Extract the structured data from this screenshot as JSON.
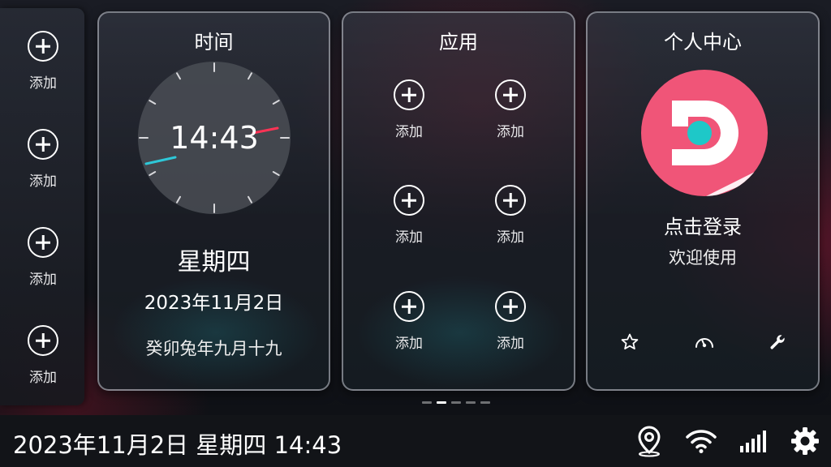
{
  "dock": {
    "slots": [
      {
        "label": "添加"
      },
      {
        "label": "添加"
      },
      {
        "label": "添加"
      },
      {
        "label": "添加"
      }
    ]
  },
  "time_card": {
    "title": "时间",
    "clock_time": "14:43",
    "weekday": "星期四",
    "date": "2023年11月2日",
    "lunar_date": "癸卯兔年九月十九"
  },
  "apps_card": {
    "title": "应用",
    "slots": [
      {
        "label": "添加"
      },
      {
        "label": "添加"
      },
      {
        "label": "添加"
      },
      {
        "label": "添加"
      },
      {
        "label": "添加"
      },
      {
        "label": "添加"
      }
    ]
  },
  "user_card": {
    "title": "个人中心",
    "avatar_icon": "brand-d-logo-icon",
    "login_text": "点击登录",
    "welcome_text": "欢迎使用",
    "actions": [
      "star-icon",
      "speedometer-icon",
      "wrench-icon"
    ]
  },
  "pager": {
    "page_count": 5,
    "active_page": 2
  },
  "status_bar": {
    "datetime_text": "2023年11月2日 星期四 14:43",
    "icons": [
      "location-pin-icon",
      "wifi-icon",
      "signal-bars-icon",
      "settings-gear-icon"
    ]
  },
  "colors": {
    "avatar_bg": "#f05578",
    "avatar_dot": "#1ec8c8",
    "second_hand": "#ff3355",
    "minute_hand": "#2ec8d8"
  }
}
